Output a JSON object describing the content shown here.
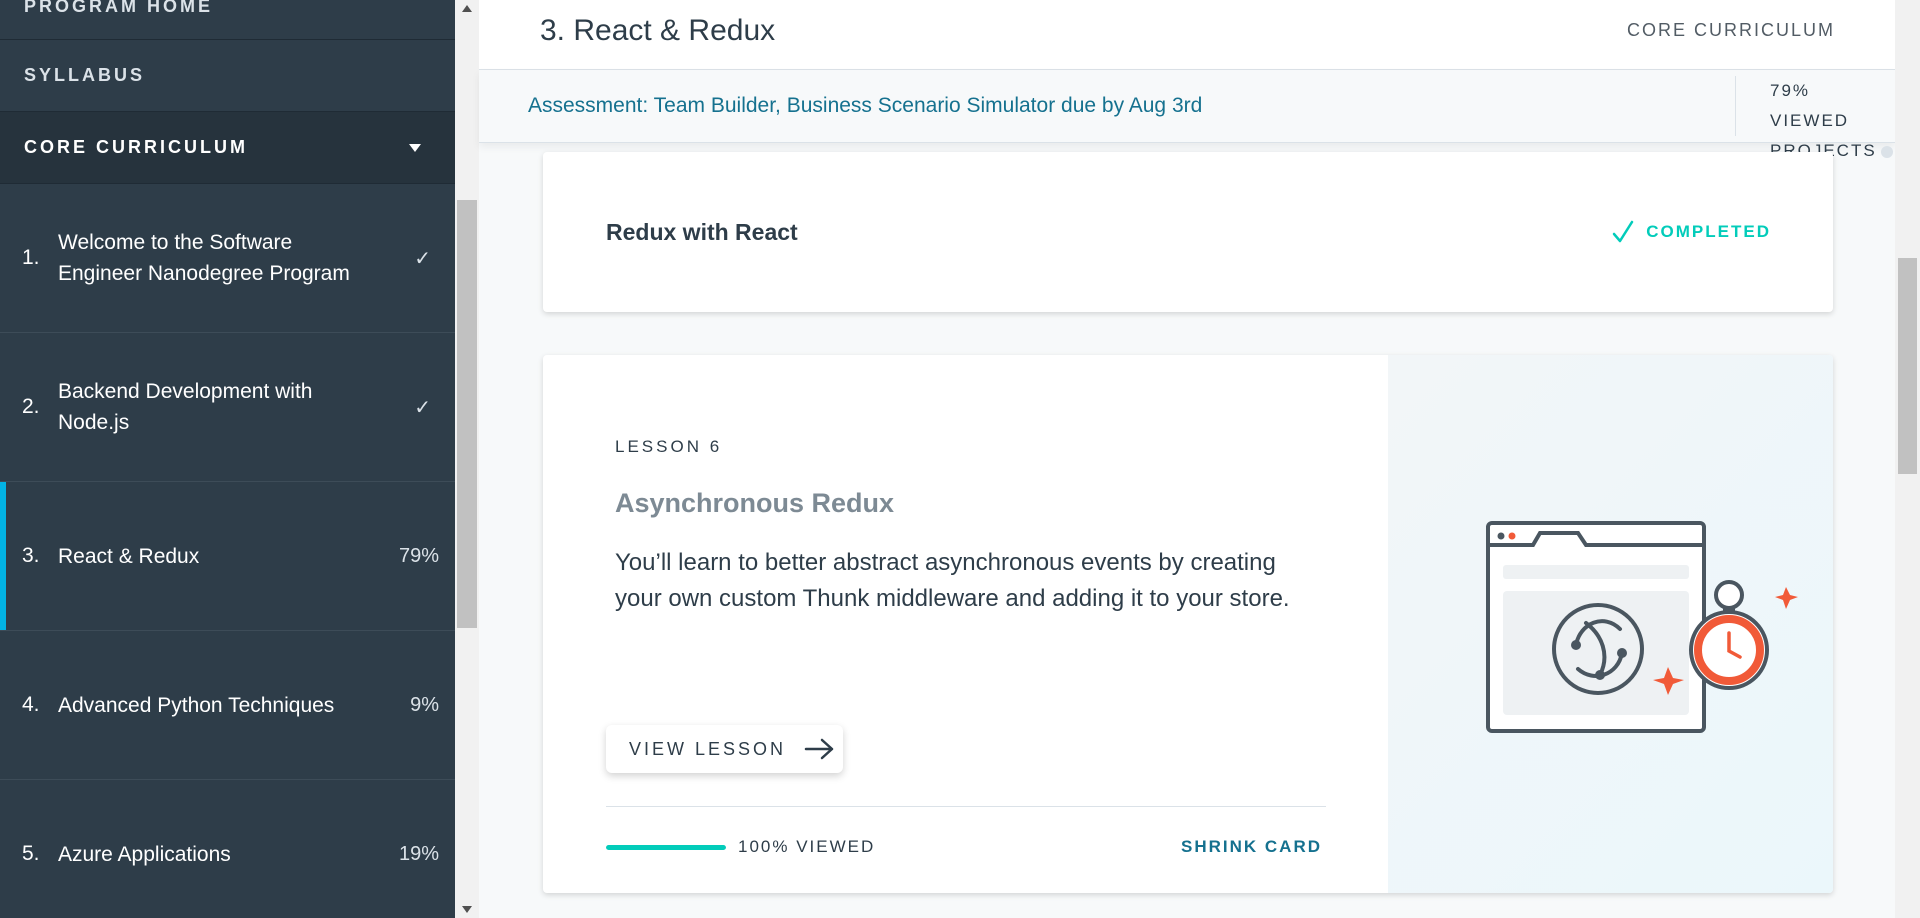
{
  "sidebar": {
    "program_home": "PROGRAM HOME",
    "syllabus": "SYLLABUS",
    "core_curriculum": "CORE CURRICULUM",
    "courses": [
      {
        "num": "1.",
        "title": "Welcome to the Software Engineer Nanodegree Program",
        "status": "✓"
      },
      {
        "num": "2.",
        "title": "Backend Development with Node.js",
        "status": "✓"
      },
      {
        "num": "3.",
        "title": "React & Redux",
        "status": "79%"
      },
      {
        "num": "4.",
        "title": "Advanced Python Techniques",
        "status": "9%"
      },
      {
        "num": "5.",
        "title": "Azure Applications",
        "status": "19%"
      }
    ]
  },
  "header": {
    "title": "3. React & Redux",
    "section": "CORE CURRICULUM"
  },
  "banner": {
    "assessment": "Assessment: Team Builder, Business Scenario Simulator due by Aug 3rd",
    "viewed": "79% VIEWED",
    "projects": "PROJECTS"
  },
  "completed_card": {
    "title": "Redux with React",
    "status": "COMPLETED"
  },
  "lesson_card": {
    "eyebrow": "LESSON 6",
    "title": "Asynchronous Redux",
    "description": "You’ll learn to better abstract asynchronous events by creating your own custom Thunk middleware and adding it to your store.",
    "button": "VIEW LESSON",
    "progress_percent": 100,
    "progress_label": "100% VIEWED",
    "shrink": "SHRINK CARD"
  },
  "colors": {
    "sidebar_bg": "#2e3d49",
    "accent_blue": "#02b3e4",
    "teal": "#02ccba",
    "link": "#15718f"
  }
}
